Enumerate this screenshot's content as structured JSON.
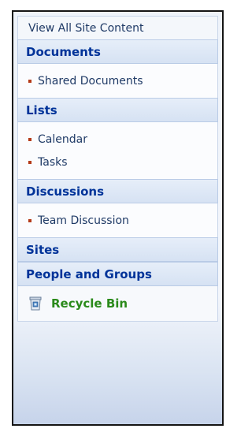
{
  "nav": {
    "view_all": "View All Site Content",
    "sections": [
      {
        "title": "Documents",
        "items": [
          "Shared Documents"
        ]
      },
      {
        "title": "Lists",
        "items": [
          "Calendar",
          "Tasks"
        ]
      },
      {
        "title": "Discussions",
        "items": [
          "Team Discussion"
        ]
      },
      {
        "title": "Sites",
        "items": []
      },
      {
        "title": "People and Groups",
        "items": []
      }
    ],
    "recycle_bin": "Recycle Bin"
  },
  "icons": {
    "bullet": "bullet-icon",
    "recycle_bin": "recycle-bin-icon"
  },
  "colors": {
    "header_text": "#003399",
    "bullet": "#b43a18",
    "recycle_text": "#2a8a1a"
  }
}
